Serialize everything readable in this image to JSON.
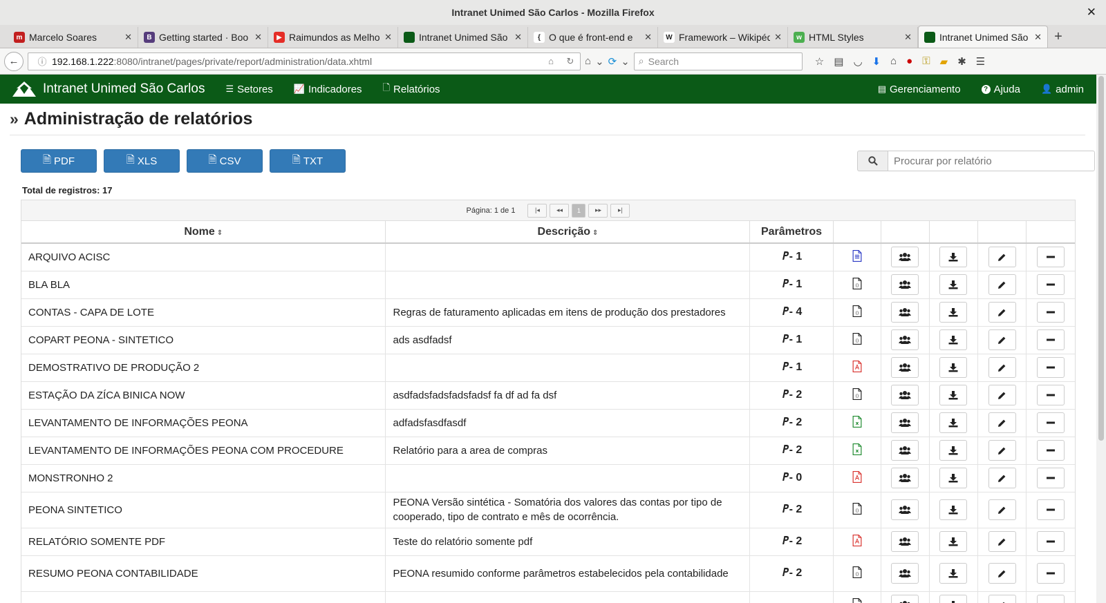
{
  "window": {
    "title": "Intranet Unimed São Carlos - Mozilla Firefox",
    "close_glyph": "✕"
  },
  "tabs": [
    {
      "label": "Marcelo Soares",
      "fav_color": "#c21f1f",
      "fav_text": "m"
    },
    {
      "label": "Getting started · Boo",
      "fav_color": "#563d7c",
      "fav_text": "B"
    },
    {
      "label": "Raimundos as Melho",
      "fav_color": "#e52d27",
      "fav_text": "▶"
    },
    {
      "label": "Intranet Unimed São",
      "fav_color": "#0b5a17",
      "fav_text": ""
    },
    {
      "label": "O que é front-end e",
      "fav_color": "#ffffff",
      "fav_text": "{"
    },
    {
      "label": "Framework – Wikipéd",
      "fav_color": "#ffffff",
      "fav_text": "W"
    },
    {
      "label": "HTML Styles",
      "fav_color": "#4caf50",
      "fav_text": "w"
    },
    {
      "label": "Intranet Unimed São",
      "fav_color": "#0b5a17",
      "fav_text": "",
      "active": true
    }
  ],
  "newtab": "+",
  "urlbar": {
    "host": "192.168.1.222",
    "rest": ":8080/intranet/pages/private/report/administration/data.xhtml"
  },
  "browser_search": {
    "placeholder": "Search"
  },
  "app": {
    "brand": "Intranet Unimed São Carlos",
    "nav_left": [
      {
        "label": "Setores",
        "icon": "list-icon"
      },
      {
        "label": "Indicadores",
        "icon": "chart-icon"
      },
      {
        "label": "Relatórios",
        "icon": "file-icon"
      }
    ],
    "nav_right": [
      {
        "label": "Gerenciamento",
        "icon": "manage-icon"
      },
      {
        "label": "Ajuda",
        "icon": "help-icon"
      },
      {
        "label": "admin",
        "icon": "user-icon"
      }
    ]
  },
  "page": {
    "title": "Administração de relatórios",
    "exports": [
      {
        "label": "PDF"
      },
      {
        "label": "XLS"
      },
      {
        "label": "CSV"
      },
      {
        "label": "TXT"
      }
    ],
    "search_placeholder": "Procurar por relatório",
    "total_label": "Total de registros: 17",
    "pager": {
      "label": "Página: 1 de 1",
      "first": "|◂",
      "prev": "◂◂",
      "current": "1",
      "next": "▸▸",
      "last": "▸|"
    },
    "columns": {
      "name": "Nome",
      "description": "Descrição",
      "params": "Parâmetros"
    },
    "rows": [
      {
        "name": "ARQUIVO ACISC",
        "description": "",
        "params": "- 1",
        "type": "txt"
      },
      {
        "name": "BLA BLA",
        "description": "",
        "params": "- 1",
        "type": "csv"
      },
      {
        "name": "CONTAS - CAPA DE LOTE",
        "description": "Regras de faturamento aplicadas em itens de produção dos prestadores",
        "params": "- 4",
        "type": "csv"
      },
      {
        "name": "COPART PEONA - SINTETICO",
        "description": "ads asdfadsf",
        "params": "- 1",
        "type": "csv"
      },
      {
        "name": "DEMOSTRATIVO DE PRODUÇÃO 2",
        "description": "",
        "params": "- 1",
        "type": "pdf"
      },
      {
        "name": "ESTAÇÃO DA ZÍCA BINICA NOW",
        "description": "asdfadsfadsfadsfadsf fa df ad fa dsf",
        "params": "- 2",
        "type": "csv"
      },
      {
        "name": "LEVANTAMENTO DE INFORMAÇÕES PEONA",
        "description": "adfadsfasdfasdf",
        "params": "- 2",
        "type": "xls"
      },
      {
        "name": "LEVANTAMENTO DE INFORMAÇÕES PEONA COM PROCEDURE",
        "description": "Relatório para a area de compras",
        "params": "- 2",
        "type": "xls"
      },
      {
        "name": "MONSTRONHO 2",
        "description": "",
        "params": "- 0",
        "type": "pdf"
      },
      {
        "name": "PEONA SINTETICO",
        "description": "PEONA Versão sintética - Somatória dos valores das contas por tipo de cooperado, tipo de contrato e mês de ocorrência.",
        "params": "- 2",
        "type": "csv",
        "tall": true
      },
      {
        "name": "RELATÓRIO SOMENTE PDF",
        "description": "Teste do relatório somente pdf",
        "params": "- 2",
        "type": "pdf"
      },
      {
        "name": "RESUMO PEONA CONTABILIDADE",
        "description": "PEONA resumido conforme parâmetros estabelecidos pela contabilidade",
        "params": "- 2",
        "type": "csv",
        "tall": true
      },
      {
        "name": "",
        "description": "",
        "params": "",
        "type": "csv"
      }
    ]
  },
  "colors": {
    "navbar": "#0b5a17",
    "primary": "#337ab7",
    "pdf": "#d9302c",
    "xls": "#1e8a2e",
    "txt": "#2a38c4"
  }
}
